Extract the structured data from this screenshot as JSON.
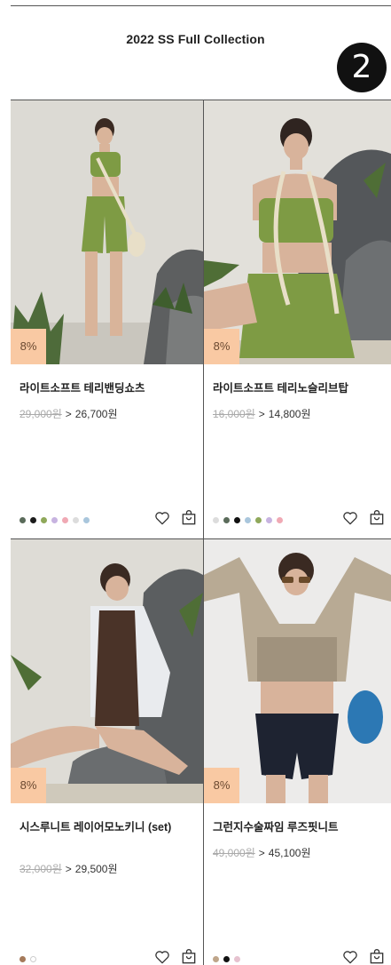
{
  "header": {
    "title": "2022 SS Full Collection",
    "step_badge": "2"
  },
  "colors": {
    "discount_bg": "#f9c9a3",
    "rule": "#555555"
  },
  "products": [
    {
      "name": "라이트소프트 테리밴딩쇼츠",
      "original_price": "29,000원",
      "sale_price": "26,700원",
      "discount": "8%",
      "swatches": [
        "#5a6b5a",
        "#1b1b1b",
        "#8fa85a",
        "#c7b3e0",
        "#f0a9b4",
        "#dcdcdc",
        "#a9c6dc"
      ]
    },
    {
      "name": "라이트소프트 테리노슬리브탑",
      "original_price": "16,000원",
      "sale_price": "14,800원",
      "discount": "8%",
      "swatches": [
        "#dcdcdc",
        "#5a6b5a",
        "#111111",
        "#a9c6dc",
        "#8fa85a",
        "#c7b3e0",
        "#f0a9b4"
      ]
    },
    {
      "name": "시스루니트 레이어모노키니 (set)",
      "original_price": "32,000원",
      "sale_price": "29,500원",
      "discount": "8%",
      "swatches": [
        "#a57a5a",
        "#ffffff"
      ]
    },
    {
      "name": "그런지수술짜임 루즈핏니트",
      "original_price": "49,000원",
      "sale_price": "45,100원",
      "discount": "8%",
      "swatches": [
        "#bfa58a",
        "#111111",
        "#e6c2cf"
      ]
    }
  ],
  "icons": {
    "wishlist": "heart-icon",
    "cart": "shopping-bag-icon"
  }
}
